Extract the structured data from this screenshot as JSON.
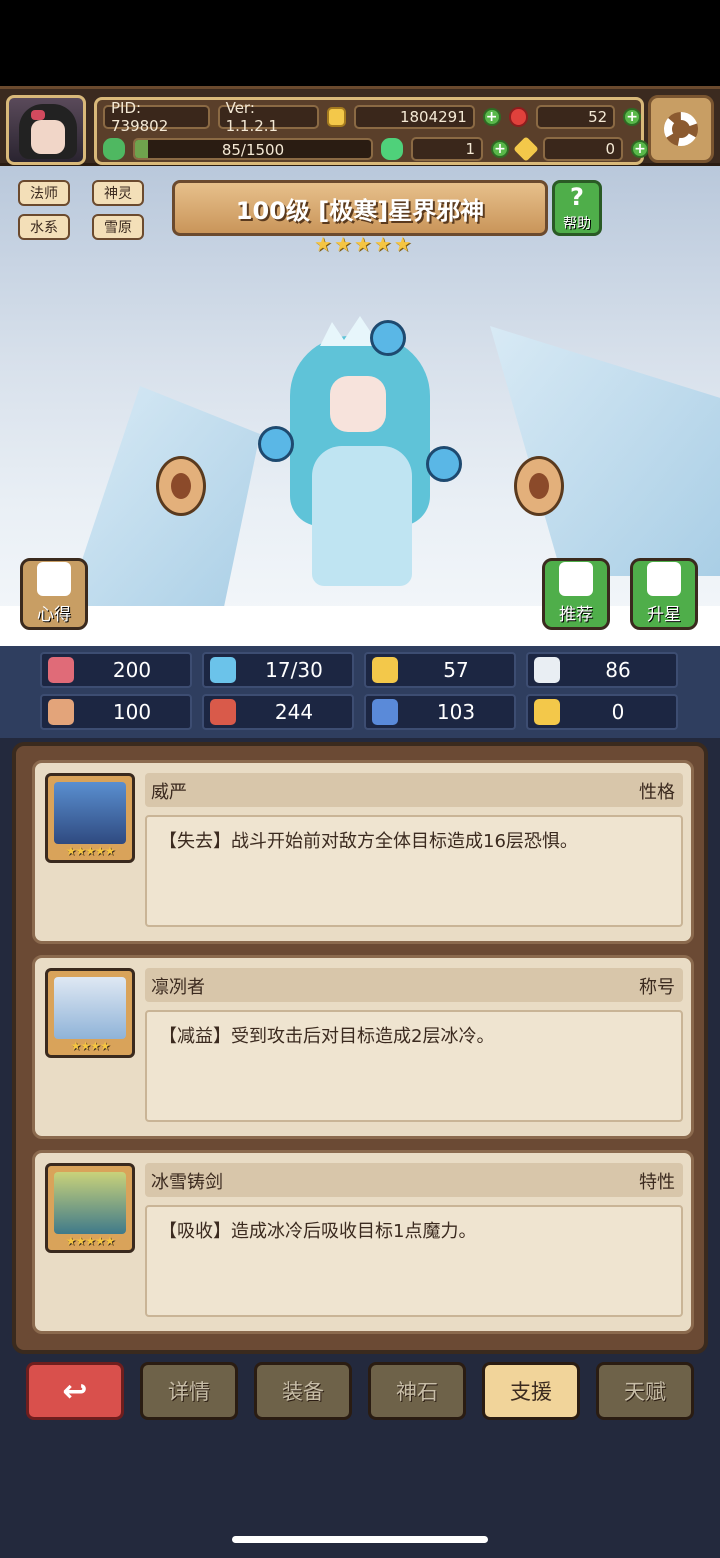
{
  "header": {
    "pid": "PID: 739802",
    "version": "Ver: 1.1.2.1",
    "gold": "1804291",
    "rubies": "52",
    "xp_text": "85/1500",
    "xp_progress": 0.0567,
    "clovers": "1",
    "keys": "0"
  },
  "tags": [
    "法师",
    "神灵",
    "水系",
    "雪原"
  ],
  "hero": {
    "name": "100级 [极寒]星界邪神",
    "stars": 5,
    "help_label": "帮助",
    "notes_label": "心得",
    "recommend_label": "推荐",
    "upgrade_label": "升星"
  },
  "stats": [
    {
      "icon": "heart-icon",
      "value": "200",
      "color": "#e06b78"
    },
    {
      "icon": "water-drop-icon",
      "value": "17/30",
      "color": "#6bc3ea"
    },
    {
      "icon": "shield-icon",
      "value": "57",
      "color": "#f3c84a"
    },
    {
      "icon": "feather-icon",
      "value": "86",
      "color": "#e9eef3"
    },
    {
      "icon": "fist-icon",
      "value": "100",
      "color": "#e3a47a"
    },
    {
      "icon": "book-icon",
      "value": "244",
      "color": "#d95a4a"
    },
    {
      "icon": "scroll-icon",
      "value": "103",
      "color": "#5a8ad9"
    },
    {
      "icon": "horseshoe-icon",
      "value": "0",
      "color": "#f3c84a"
    }
  ],
  "cards": [
    {
      "name": "威严",
      "type": "性格",
      "desc": "【失去】战斗开始前对敌方全体目标造成16层恐惧。",
      "stars": "★★★★★"
    },
    {
      "name": "凛冽者",
      "type": "称号",
      "desc": "【减益】受到攻击后对目标造成2层冰冷。",
      "stars": "★★★★"
    },
    {
      "name": "冰雪铸剑",
      "type": "特性",
      "desc": "【吸收】造成冰冷后吸收目标1点魔力。",
      "stars": "★★★★★"
    }
  ],
  "tabs": [
    {
      "label": "详情",
      "active": false
    },
    {
      "label": "装备",
      "active": false
    },
    {
      "label": "神石",
      "active": false
    },
    {
      "label": "支援",
      "active": true
    },
    {
      "label": "天赋",
      "active": false
    }
  ],
  "back_symbol": "↩"
}
